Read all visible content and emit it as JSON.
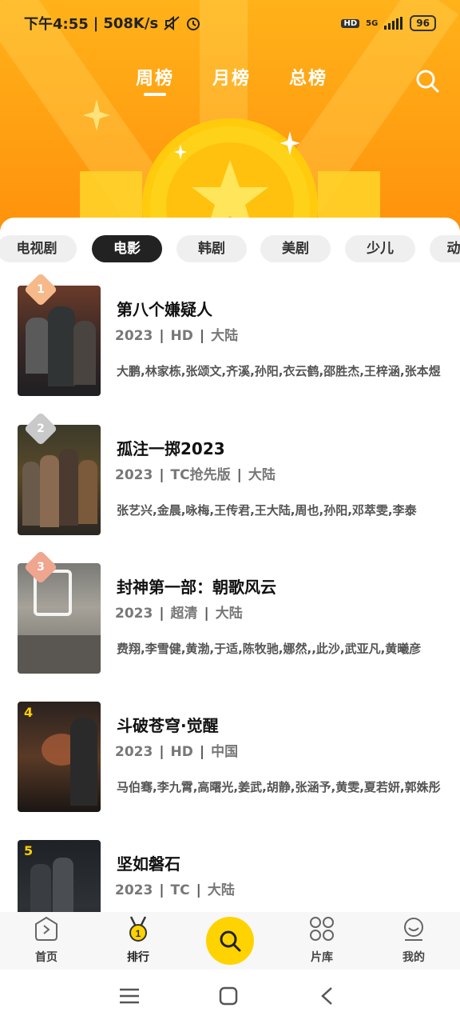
{
  "status_bar": {
    "time": "下午4:55",
    "speed": "508K/s",
    "network": "5G",
    "hd": "HD",
    "battery": "96"
  },
  "top_tabs": [
    {
      "label": "周榜",
      "active": true
    },
    {
      "label": "月榜",
      "active": false
    },
    {
      "label": "总榜",
      "active": false
    }
  ],
  "categories": [
    {
      "label": "电视剧",
      "active": false
    },
    {
      "label": "电影",
      "active": true
    },
    {
      "label": "韩剧",
      "active": false
    },
    {
      "label": "美剧",
      "active": false
    },
    {
      "label": "少儿",
      "active": false
    },
    {
      "label": "动",
      "active": false
    }
  ],
  "items": [
    {
      "rank": "1",
      "title": "第八个嫌疑人",
      "year": "2023",
      "quality": "HD",
      "region": "大陆",
      "cast": "大鹏,林家栋,张颂文,齐溪,孙阳,衣云鹤,邵胜杰,王梓涵,张本煜"
    },
    {
      "rank": "2",
      "title": "孤注一掷2023",
      "year": "2023",
      "quality": "TC抢先版",
      "region": "大陆",
      "cast": "张艺兴,金晨,咏梅,王传君,王大陆,周也,孙阳,邓萃雯,李泰"
    },
    {
      "rank": "3",
      "title": "封神第一部：朝歌风云",
      "year": "2023",
      "quality": "超清",
      "region": "大陆",
      "cast": "费翔,李雪健,黄渤,于适,陈牧驰,娜然,,此沙,武亚凡,黄曦彦"
    },
    {
      "rank": "4",
      "title": "斗破苍穹·觉醒",
      "year": "2023",
      "quality": "HD",
      "region": "中国",
      "cast": "马伯骞,李九霄,高曙光,姜武,胡静,张涵予,黄雯,夏若妍,郭姝彤"
    },
    {
      "rank": "5",
      "title": "坚如磐石",
      "year": "2023",
      "quality": "TC",
      "region": "大陆",
      "cast": ""
    }
  ],
  "bottom_nav": [
    {
      "label": "首页",
      "icon": "home-play-icon"
    },
    {
      "label": "排行",
      "icon": "medal-icon",
      "badge": "1"
    },
    {
      "label": "片库",
      "icon": "grid-icon"
    },
    {
      "label": "我的",
      "icon": "profile-icon"
    }
  ],
  "colors": {
    "accent": "#ffd300",
    "hero": "#ff9c10",
    "rank1": "#f6b98a",
    "rank2": "#c9c9c9",
    "rank3": "#f0a58f"
  }
}
